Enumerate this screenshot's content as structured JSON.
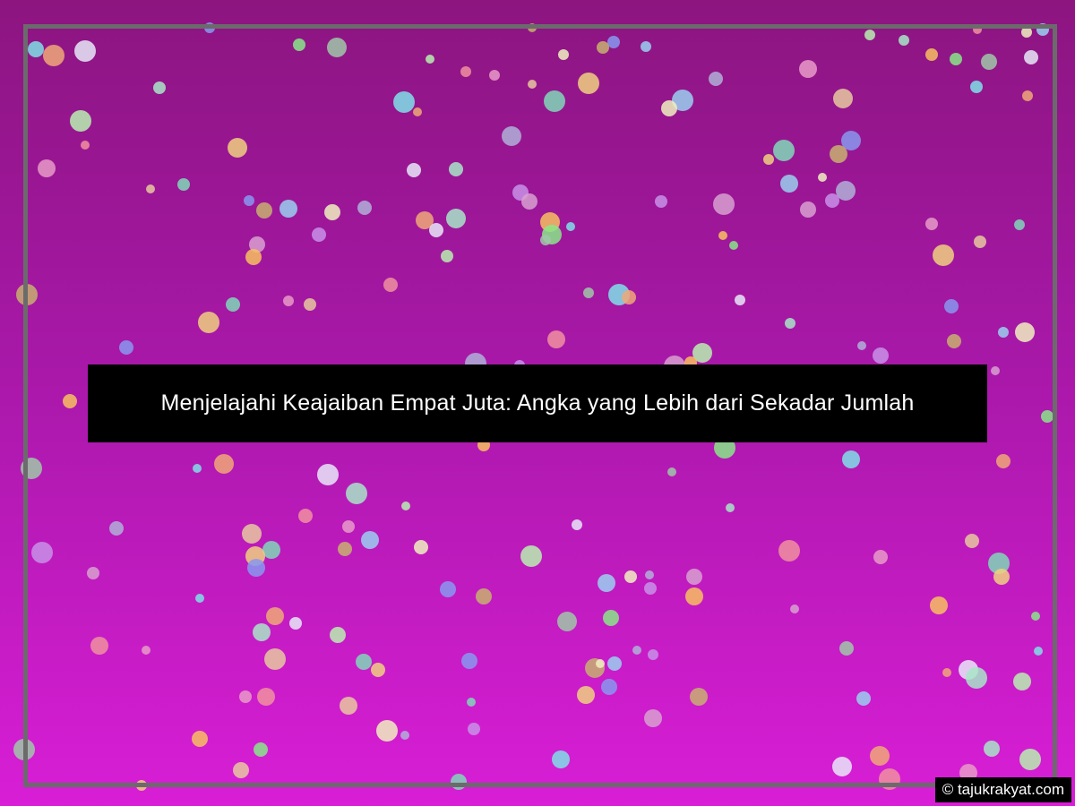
{
  "title": "Menjelajahi Keajaiban Empat Juta: Angka yang Lebih dari Sekadar Jumlah",
  "credit": "© tajukrakyat.com",
  "colors": {
    "background_top": "#8c1580",
    "background_bottom": "#d81ed6",
    "frame": "#6b6b6b",
    "banner": "#000000",
    "text": "#ffffff"
  },
  "decoration": "confetti-dots"
}
